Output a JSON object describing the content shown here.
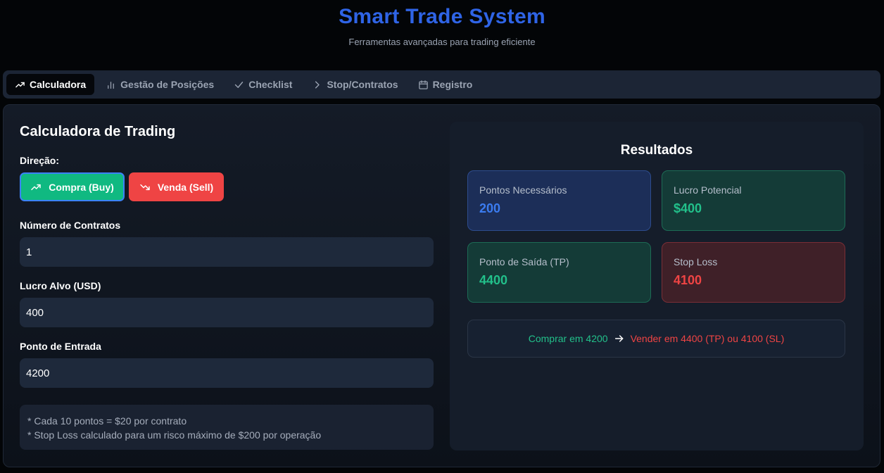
{
  "header": {
    "title": "Smart Trade System",
    "subtitle": "Ferramentas avançadas para trading eficiente"
  },
  "tabs": [
    {
      "label": "Calculadora",
      "icon": "trending-up-icon",
      "active": true
    },
    {
      "label": "Gestão de Posições",
      "icon": "bar-chart-icon",
      "active": false
    },
    {
      "label": "Checklist",
      "icon": "check-icon",
      "active": false
    },
    {
      "label": "Stop/Contratos",
      "icon": "chevron-right-icon",
      "active": false
    },
    {
      "label": "Registro",
      "icon": "calendar-icon",
      "active": false
    }
  ],
  "calculator": {
    "title": "Calculadora de Trading",
    "direction_label": "Direção:",
    "buy_label": "Compra (Buy)",
    "sell_label": "Venda (Sell)",
    "contracts_label": "Número de Contratos",
    "contracts_value": "1",
    "target_label": "Lucro Alvo (USD)",
    "target_value": "400",
    "entry_label": "Ponto de Entrada",
    "entry_value": "4200",
    "note1": "* Cada 10 pontos = $20 por contrato",
    "note2": "* Stop Loss calculado para um risco máximo de $200 por operação"
  },
  "results": {
    "title": "Resultados",
    "points_label": "Pontos Necessários",
    "points_value": "200",
    "profit_label": "Lucro Potencial",
    "profit_value": "$400",
    "exit_label": "Ponto de Saída (TP)",
    "exit_value": "4400",
    "stop_label": "Stop Loss",
    "stop_value": "4100",
    "summary_buy": "Comprar em 4200",
    "summary_sell": "Vender em 4400 (TP) ou 4100 (SL)"
  },
  "colors": {
    "accent_blue": "#2f64e6",
    "buy_green": "#10b981",
    "sell_red": "#ef4444"
  }
}
